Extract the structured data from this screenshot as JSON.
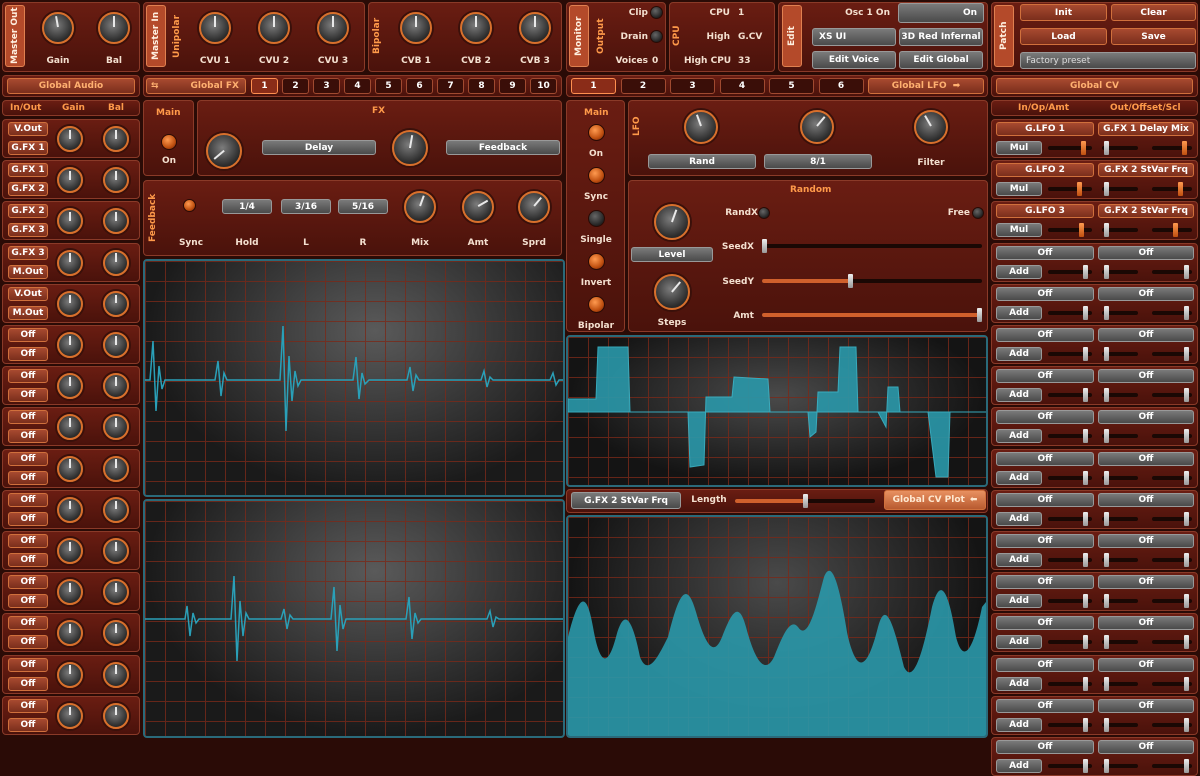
{
  "top": {
    "master_out": "Master Out",
    "gain": "Gain",
    "bal": "Bal",
    "master_in": "Master In",
    "unipolar": "Unipolar",
    "cvu": [
      "CVU 1",
      "CVU 2",
      "CVU 3"
    ],
    "bipolar": "Bipolar",
    "cvb": [
      "CVB 1",
      "CVB 2",
      "CVB 3"
    ],
    "monitor": "Monitor",
    "output": "Output",
    "clip": "Clip",
    "drain": "Drain",
    "voices_label": "Voices",
    "voices_value": "0",
    "cpu_vert": "CPU",
    "cpu_label": "CPU",
    "cpu_value": "1",
    "high_label": "High",
    "high_value": "G.CV",
    "highcpu_label": "High CPU",
    "highcpu_value": "33",
    "edit": "Edit",
    "osc_label": "Osc 1 On",
    "osc_toggle": "On",
    "xs_ui": "XS UI",
    "red_infernal": "3D Red Infernal",
    "edit_voice": "Edit Voice",
    "edit_global": "Edit Global",
    "patch": "Patch",
    "init": "Init",
    "clear": "Clear",
    "load": "Load",
    "save": "Save",
    "preset": "Factory preset"
  },
  "bars": {
    "global_audio": "Global Audio",
    "global_fx": "Global FX",
    "fx_tabs": [
      "1",
      "2",
      "3",
      "4",
      "5",
      "6",
      "7",
      "8",
      "9",
      "10"
    ],
    "lfo_tabs": [
      "1",
      "2",
      "3",
      "4",
      "5",
      "6"
    ],
    "global_lfo": "Global LFO",
    "global_cv": "Global CV"
  },
  "audio": {
    "h_io": "In/Out",
    "h_gain": "Gain",
    "h_bal": "Bal",
    "rows": [
      [
        "V.Out",
        "G.FX 1"
      ],
      [
        "G.FX 1",
        "G.FX 2"
      ],
      [
        "G.FX 2",
        "G.FX 3"
      ],
      [
        "G.FX 3",
        "M.Out"
      ],
      [
        "V.Out",
        "M.Out"
      ],
      [
        "Off",
        "Off"
      ],
      [
        "Off",
        "Off"
      ],
      [
        "Off",
        "Off"
      ],
      [
        "Off",
        "Off"
      ],
      [
        "Off",
        "Off"
      ],
      [
        "Off",
        "Off"
      ],
      [
        "Off",
        "Off"
      ],
      [
        "Off",
        "Off"
      ],
      [
        "Off",
        "Off"
      ],
      [
        "Off",
        "Off"
      ]
    ]
  },
  "fx": {
    "main": "Main",
    "on": "On",
    "fx": "FX",
    "delay": "Delay",
    "feedback_btn": "Feedback",
    "feedback_vert": "Feedback",
    "t1": "1/4",
    "t2": "3/16",
    "t3": "5/16",
    "sync": "Sync",
    "hold": "Hold",
    "l": "L",
    "r": "R",
    "mix": "Mix",
    "amt": "Amt",
    "sprd": "Sprd"
  },
  "lfo": {
    "main": "Main",
    "on": "On",
    "sync": "Sync",
    "single": "Single",
    "invert": "Invert",
    "bipolar": "Bipolar",
    "lfo": "LFO",
    "rand": "Rand",
    "rate": "8/1",
    "filter": "Filter",
    "random": "Random",
    "randx": "RandX",
    "free": "Free",
    "seedx": "SeedX",
    "seedy": "SeedY",
    "amt": "Amt",
    "level": "Level",
    "steps": "Steps",
    "target": "G.FX 2 StVar Frq",
    "length": "Length",
    "plot": "Global CV Plot",
    "seedx_level": 0.0,
    "seedy_level": 0.4,
    "amt_level": 1.0,
    "length_level": 0.5
  },
  "cv": {
    "h_in": "In/Op/Amt",
    "h_out": "Out/Offset/Scl",
    "rows": [
      [
        "G.LFO 1",
        "G.FX 1 Delay Mix",
        "Mul"
      ],
      [
        "G.LFO 2",
        "G.FX 2 StVar Frq",
        "Mul"
      ],
      [
        "G.LFO 3",
        "G.FX 2 StVar Frq",
        "Mul"
      ],
      [
        "Off",
        "Off",
        "Add"
      ],
      [
        "Off",
        "Off",
        "Add"
      ],
      [
        "Off",
        "Off",
        "Add"
      ],
      [
        "Off",
        "Off",
        "Add"
      ],
      [
        "Off",
        "Off",
        "Add"
      ],
      [
        "Off",
        "Off",
        "Add"
      ],
      [
        "Off",
        "Off",
        "Add"
      ],
      [
        "Off",
        "Off",
        "Add"
      ],
      [
        "Off",
        "Off",
        "Add"
      ],
      [
        "Off",
        "Off",
        "Add"
      ],
      [
        "Off",
        "Off",
        "Add"
      ],
      [
        "Off",
        "Off",
        "Add"
      ],
      [
        "Off",
        "Off",
        "Add"
      ]
    ]
  }
}
